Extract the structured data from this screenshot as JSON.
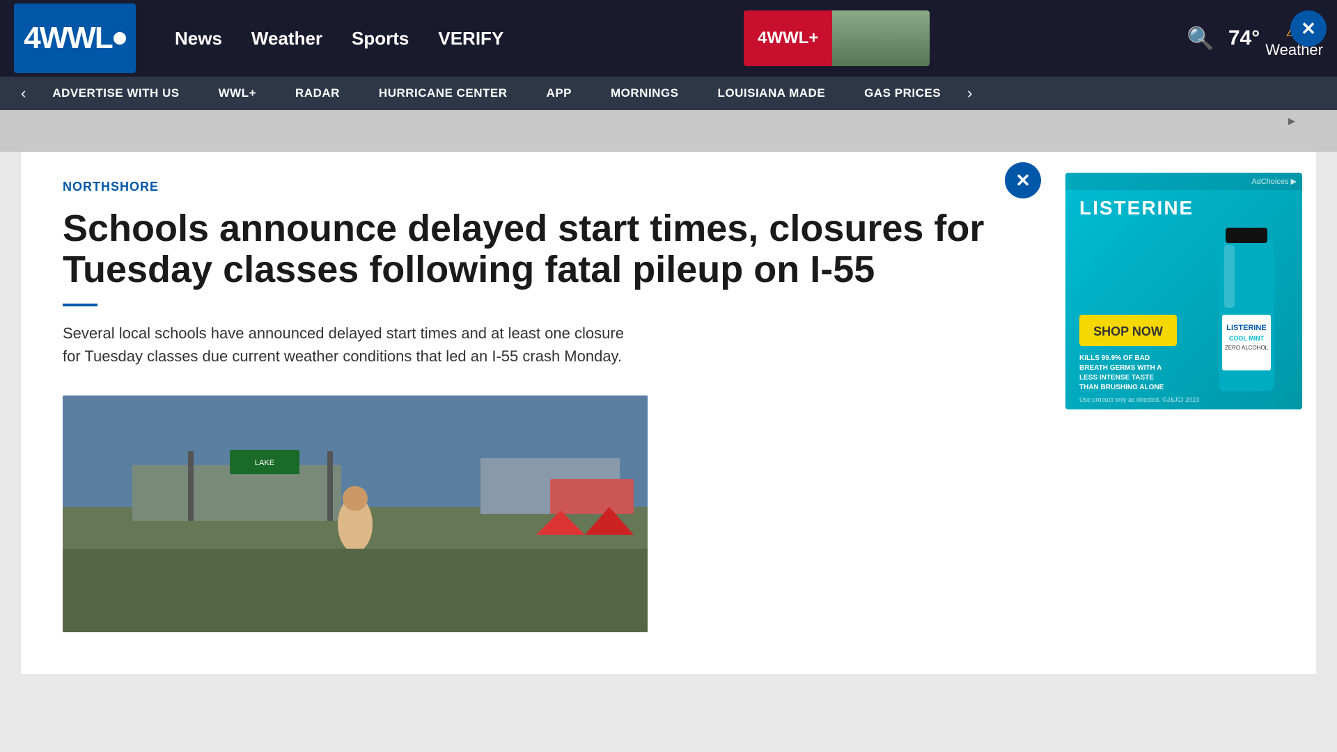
{
  "site": {
    "logo_text": "4WWL",
    "logo_circle": "●"
  },
  "top_nav": {
    "news_label": "News",
    "weather_label": "Weather",
    "sports_label": "Sports",
    "verify_label": "VERIFY",
    "wwlplus_label": "4WWL+",
    "search_icon": "🔍",
    "temperature": "74°",
    "weather_right_label": "Weather",
    "weather_icon": "⚠"
  },
  "sub_nav": {
    "prev_arrow": "‹",
    "next_arrow": "›",
    "items": [
      {
        "label": "ADVERTISE WITH US"
      },
      {
        "label": "WWL+"
      },
      {
        "label": "RADAR"
      },
      {
        "label": "HURRICANE CENTER"
      },
      {
        "label": "APP"
      },
      {
        "label": "MORNINGS"
      },
      {
        "label": "LOUISIANA MADE"
      },
      {
        "label": "GAS PRICES"
      }
    ]
  },
  "ad_top": {
    "indicator": "▶"
  },
  "article": {
    "category": "NORTHSHORE",
    "title": "Schools announce delayed start times, closures for Tuesday classes following fatal pileup on I-55",
    "summary": "Several local schools have announced delayed start times and at least one closure for Tuesday classes due current weather conditions that led an I-55 crash Monday.",
    "close_label": "✕"
  },
  "sidebar_ad": {
    "brand": "LISTERINE",
    "ad_choices": "AdChoices ▶",
    "shop_label": "SHOP NOW",
    "product_name": "LISTERINE",
    "product_type": "COOL MINT",
    "product_sub": "ZERO ALCOHOL",
    "tagline": "KILLS 99.9% OF BAD BREATH GERMS WITH A LESS INTENSE TASTE THAN BRUSHING ALONE",
    "disclaimer": "Use product only as directed. ©J&JCI 2023"
  },
  "close_btn": {
    "label": "✕"
  }
}
